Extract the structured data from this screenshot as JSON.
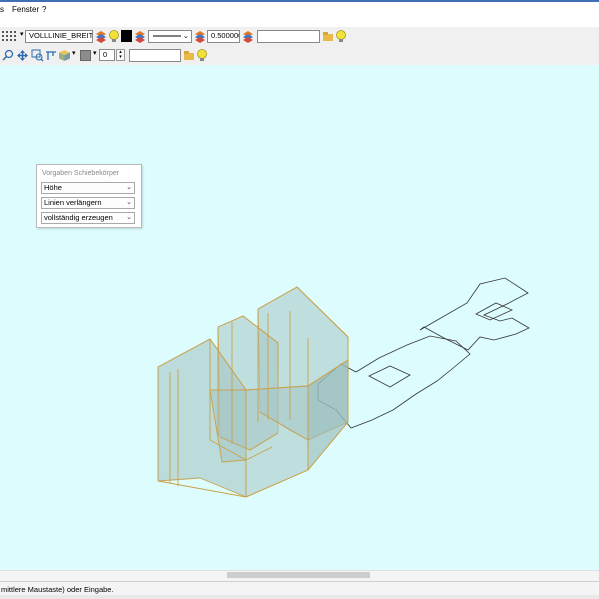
{
  "menu": {
    "items": [
      {
        "label": "s"
      },
      {
        "label": "Fenster"
      },
      {
        "label": "?"
      }
    ]
  },
  "toolbar1": {
    "linetype_value": "VOLLLINIE_BREIT",
    "width_value": "0.500000",
    "text_field_value": ""
  },
  "toolbar2": {
    "counter_value": "0",
    "text_field_value": ""
  },
  "panel": {
    "title": "Vorgaben Schiebekörper",
    "dropdowns": [
      {
        "value": "Höhe"
      },
      {
        "value": "Linien verlängern"
      },
      {
        "value": "vollständig erzeugen"
      }
    ]
  },
  "status": {
    "text": "mittlere Maustaste) oder Eingabe."
  },
  "colors": {
    "canvas": "#ddfcfd",
    "solid_fill": "#a6c5c4",
    "solid_edge": "#c9a24a",
    "outline": "#333333"
  },
  "icons": [
    "grid-icon",
    "layer-stack-icon",
    "bulb-icon",
    "color-swatch-icon",
    "linestyle-icon",
    "zoom-icon",
    "pan-icon",
    "cube-icon",
    "folder-icon"
  ]
}
